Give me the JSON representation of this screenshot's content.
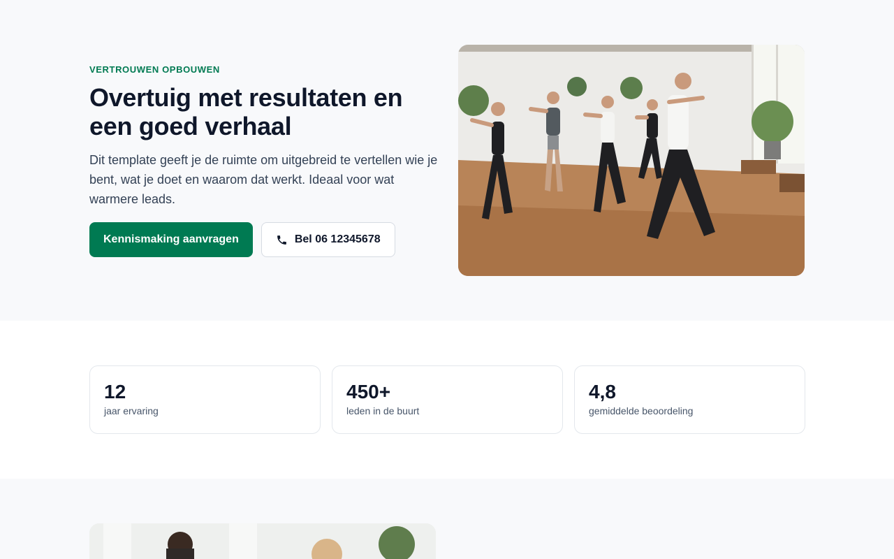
{
  "hero": {
    "eyebrow": "VERTROUWEN OPBOUWEN",
    "headline": "Overtuig met resultaten en een goed verhaal",
    "lead": "Dit template geeft je de ruimte om uitgebreid te vertellen wie je bent, wat je doet en waarom dat werkt. Ideaal voor wat warmere leads.",
    "primary_cta": "Kennismaking aanvragen",
    "secondary_cta": "Bel 06 12345678",
    "secondary_icon": "phone-icon",
    "image_description": "group-fitness-class-photo"
  },
  "stats": [
    {
      "value": "12",
      "label": "jaar ervaring"
    },
    {
      "value": "450+",
      "label": "leden in de buurt"
    },
    {
      "value": "4,8",
      "label": "gemiddelde beoordeling"
    }
  ],
  "colors": {
    "accent": "#007a52",
    "heading": "#0f172a",
    "body_text": "#334155",
    "background": "#f8f9fb"
  }
}
